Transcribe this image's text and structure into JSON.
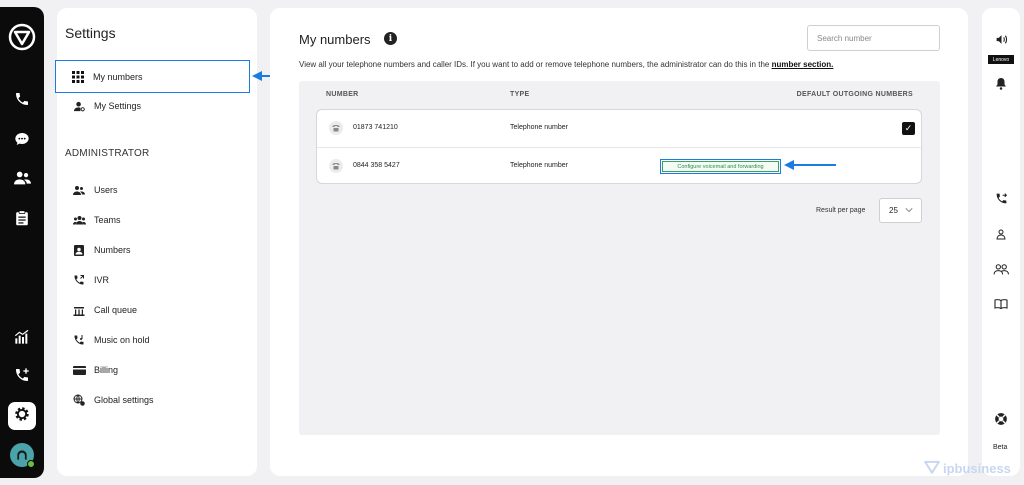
{
  "settings": {
    "title": "Settings",
    "my_numbers": "My numbers",
    "my_settings": "My Settings",
    "admin_header": "ADMINISTRATOR",
    "admin_items": [
      "Users",
      "Teams",
      "Numbers",
      "IVR",
      "Call queue",
      "Music on hold",
      "Billing",
      "Global settings"
    ]
  },
  "main": {
    "title": "My numbers",
    "info": "i",
    "description": "View all your telephone numbers and caller IDs. If you want to add or remove telephone numbers, the administrator can do this in the ",
    "description_link": "number section.",
    "search_placeholder": "Search number",
    "columns": {
      "number": "NUMBER",
      "type": "TYPE",
      "default": "DEFAULT OUTGOING NUMBERS"
    },
    "rows": [
      {
        "number": "01873 741210",
        "type": "Telephone number",
        "default_checked": true
      },
      {
        "number": "0844 358 5427",
        "type": "Telephone number",
        "configure_label": "Configure voicemail and forwarding"
      }
    ],
    "rpp_label": "Result per page",
    "rpp_value": "25"
  },
  "right_rail": {
    "lenovo": "Lenovo",
    "beta": "Beta"
  },
  "watermark": "ipbusiness",
  "colors": {
    "accent": "#1a7be0",
    "green": "#3aa35c"
  }
}
